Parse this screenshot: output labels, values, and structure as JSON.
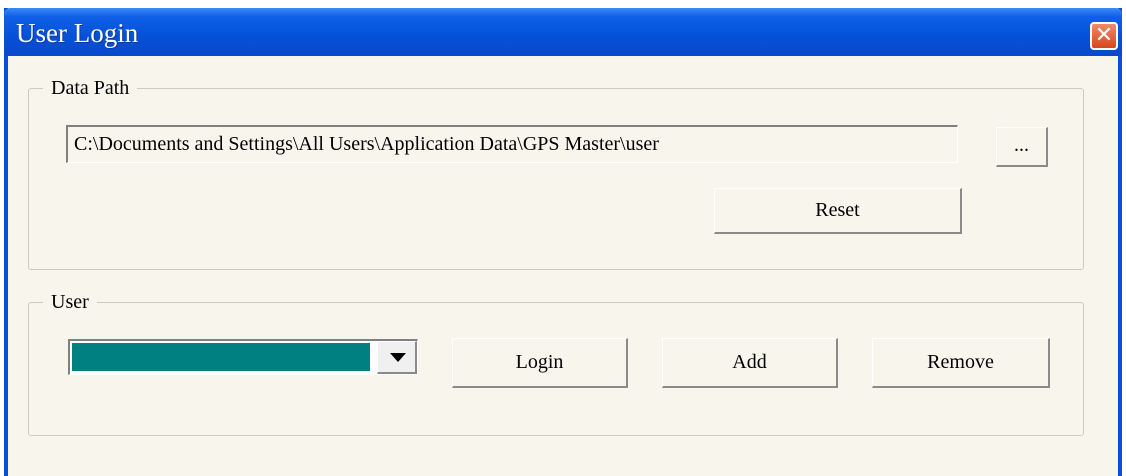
{
  "window": {
    "title": "User Login",
    "close_label": "✕"
  },
  "data_path": {
    "group_label": "Data Path",
    "path_value": "C:\\Documents and Settings\\All Users\\Application Data\\GPS Master\\user",
    "browse_label": "...",
    "reset_label": "Reset"
  },
  "user": {
    "group_label": "User",
    "selected_value": "",
    "login_label": "Login",
    "add_label": "Add",
    "remove_label": "Remove"
  },
  "colors": {
    "titlebar": "#0650d8",
    "combo_selection": "#008080",
    "close_button": "#d8461e"
  }
}
